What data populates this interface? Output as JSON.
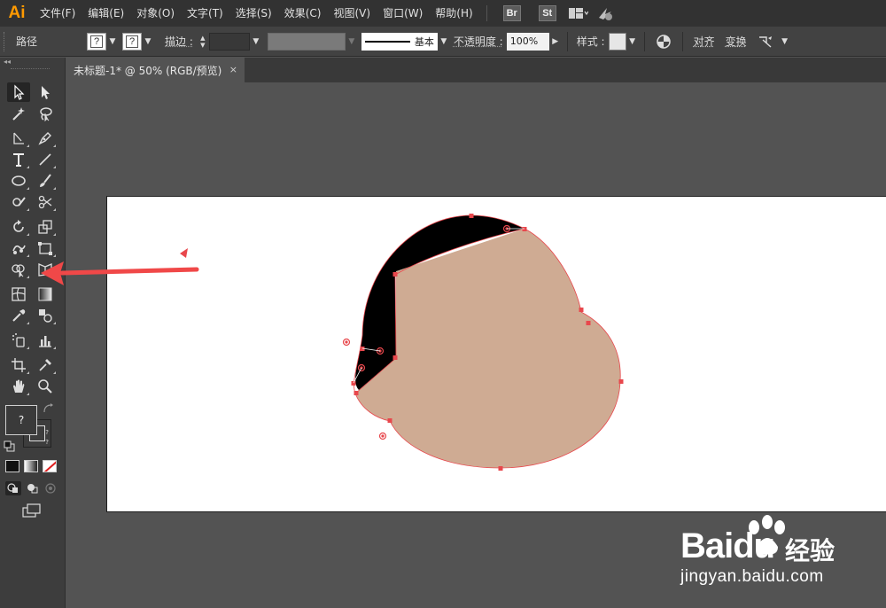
{
  "app": {
    "logo": "Ai",
    "accent": "#ff9a00"
  },
  "menu": [
    "文件(F)",
    "编辑(E)",
    "对象(O)",
    "文字(T)",
    "选择(S)",
    "效果(C)",
    "视图(V)",
    "窗口(W)",
    "帮助(H)"
  ],
  "menubar_badges": {
    "bridge": "Br",
    "stock": "St"
  },
  "controlbar": {
    "object_type": "路径",
    "fill_swatch": "?",
    "stroke_swatch": "?",
    "stroke_label": "描边 :",
    "stroke_profile": "基本",
    "opacity_label": "不透明度 :",
    "opacity_value": "100%",
    "style_label": "样式 :",
    "align_label": "对齐",
    "transform_label": "变换"
  },
  "document_tab": {
    "title": "未标题-1* @ 50% (RGB/预览)",
    "close": "×"
  },
  "toolbox": {
    "collapse": "◂◂",
    "fill_stroke_swatch": "?"
  },
  "artwork": {
    "shape_fill": "#cfab93",
    "shape_back": "#000000",
    "anchor_color": "#e8474c",
    "arrow_color": "#f04848"
  },
  "watermark": {
    "brand": "Baidu",
    "brand_cn": "经验",
    "url": "jingyan.baidu.com"
  }
}
